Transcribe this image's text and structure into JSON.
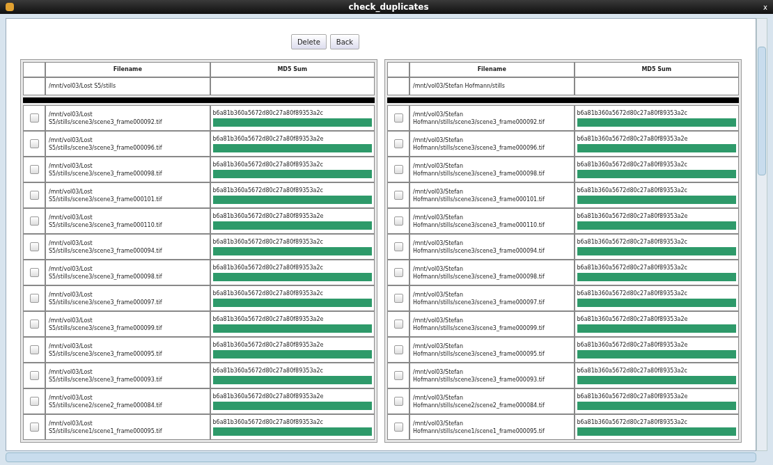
{
  "window": {
    "title": "check_duplicates",
    "close": "x"
  },
  "buttons": [
    "Delete",
    "Back"
  ],
  "tables": [
    {
      "columns": [
        "Filename",
        "MD5 Sum"
      ],
      "folder": "/mnt/vol03/Lost S5/stills",
      "rows": [
        {
          "checked": false,
          "path_1": "/mnt/vol03/Lost",
          "path_2": "S5/stills/scene3/scene3_frame000092.tif",
          "md5": "b6a81b360a5672d80c27a80f89353a2c",
          "match": true
        },
        {
          "checked": false,
          "path_1": "/mnt/vol03/Lost",
          "path_2": "S5/stills/scene3/scene3_frame000096.tif",
          "md5": "b6a81b360a5672d80c27a80f89353a2e",
          "match": true
        },
        {
          "checked": false,
          "path_1": "/mnt/vol03/Lost",
          "path_2": "S5/stills/scene3/scene3_frame000098.tif",
          "md5": "b6a81b360a5672d80c27a80f89353a2c",
          "match": true
        },
        {
          "checked": false,
          "path_1": "/mnt/vol03/Lost",
          "path_2": "S5/stills/scene3/scene3_frame000101.tif",
          "md5": "b6a81b360a5672d80c27a80f89353a2c",
          "match": true
        },
        {
          "checked": false,
          "path_1": "/mnt/vol03/Lost",
          "path_2": "S5/stills/scene3/scene3_frame000110.tif",
          "md5": "b6a81b360a5672d80c27a80f89353a2e",
          "match": true
        },
        {
          "checked": false,
          "path_1": "/mnt/vol03/Lost",
          "path_2": "S5/stills/scene3/scene3_frame000094.tif",
          "md5": "b6a81b360a5672d80c27a80f89353a2c",
          "match": true
        },
        {
          "checked": false,
          "path_1": "/mnt/vol03/Lost",
          "path_2": "S5/stills/scene3/scene3_frame000098.tif",
          "md5": "b6a81b360a5672d80c27a80f89353a2c",
          "match": true
        },
        {
          "checked": false,
          "path_1": "/mnt/vol03/Lost",
          "path_2": "S5/stills/scene3/scene3_frame000097.tif",
          "md5": "b6a81b360a5672d80c27a80f89353a2c",
          "match": true
        },
        {
          "checked": false,
          "path_1": "/mnt/vol03/Lost",
          "path_2": "S5/stills/scene3/scene3_frame000099.tif",
          "md5": "b6a81b360a5672d80c27a80f89353a2e",
          "match": true
        },
        {
          "checked": false,
          "path_1": "/mnt/vol03/Lost",
          "path_2": "S5/stills/scene3/scene3_frame000095.tif",
          "md5": "b6a81b360a5672d80c27a80f89353a2e",
          "match": true
        },
        {
          "checked": false,
          "path_1": "/mnt/vol03/Lost",
          "path_2": "S5/stills/scene3/scene3_frame000093.tif",
          "md5": "b6a81b360a5672d80c27a80f89353a2c",
          "match": true
        },
        {
          "checked": false,
          "path_1": "/mnt/vol03/Lost",
          "path_2": "S5/stills/scene2/scene2_frame000084.tif",
          "md5": "b6a81b360a5672d80c27a80f89353a2e",
          "match": true
        },
        {
          "checked": false,
          "path_1": "/mnt/vol03/Lost",
          "path_2": "S5/stills/scene1/scene1_frame000095.tif",
          "md5": "b6a81b360a5672d80c27a80f89353a2c",
          "match": true
        }
      ]
    },
    {
      "columns": [
        "Filename",
        "MD5 Sum"
      ],
      "folder": "/mnt/vol03/Stefan Hofmann/stills",
      "rows": [
        {
          "checked": false,
          "path_1": "/mnt/vol03/Stefan",
          "path_2": "Hofmann/stills/scene3/scene3_frame000092.tif",
          "md5": "b6a81b360a5672d80c27a80f89353a2c",
          "match": true
        },
        {
          "checked": false,
          "path_1": "/mnt/vol03/Stefan",
          "path_2": "Hofmann/stills/scene3/scene3_frame000096.tif",
          "md5": "b6a81b360a5672d80c27a80f89353a2e",
          "match": true
        },
        {
          "checked": false,
          "path_1": "/mnt/vol03/Stefan",
          "path_2": "Hofmann/stills/scene3/scene3_frame000098.tif",
          "md5": "b6a81b360a5672d80c27a80f89353a2c",
          "match": true
        },
        {
          "checked": false,
          "path_1": "/mnt/vol03/Stefan",
          "path_2": "Hofmann/stills/scene3/scene3_frame000101.tif",
          "md5": "b6a81b360a5672d80c27a80f89353a2c",
          "match": true
        },
        {
          "checked": false,
          "path_1": "/mnt/vol03/Stefan",
          "path_2": "Hofmann/stills/scene3/scene3_frame000110.tif",
          "md5": "b6a81b360a5672d80c27a80f89353a2e",
          "match": true
        },
        {
          "checked": false,
          "path_1": "/mnt/vol03/Stefan",
          "path_2": "Hofmann/stills/scene3/scene3_frame000094.tif",
          "md5": "b6a81b360a5672d80c27a80f89353a2c",
          "match": true
        },
        {
          "checked": false,
          "path_1": "/mnt/vol03/Stefan",
          "path_2": "Hofmann/stills/scene3/scene3_frame000098.tif",
          "md5": "b6a81b360a5672d80c27a80f89353a2c",
          "match": true
        },
        {
          "checked": false,
          "path_1": "/mnt/vol03/Stefan",
          "path_2": "Hofmann/stills/scene3/scene3_frame000097.tif",
          "md5": "b6a81b360a5672d80c27a80f89353a2c",
          "match": true
        },
        {
          "checked": false,
          "path_1": "/mnt/vol03/Stefan",
          "path_2": "Hofmann/stills/scene3/scene3_frame000099.tif",
          "md5": "b6a81b360a5672d80c27a80f89353a2e",
          "match": true
        },
        {
          "checked": false,
          "path_1": "/mnt/vol03/Stefan",
          "path_2": "Hofmann/stills/scene3/scene3_frame000095.tif",
          "md5": "b6a81b360a5672d80c27a80f89353a2e",
          "match": true
        },
        {
          "checked": false,
          "path_1": "/mnt/vol03/Stefan",
          "path_2": "Hofmann/stills/scene3/scene3_frame000093.tif",
          "md5": "b6a81b360a5672d80c27a80f89353a2c",
          "match": true
        },
        {
          "checked": false,
          "path_1": "/mnt/vol03/Stefan",
          "path_2": "Hofmann/stills/scene2/scene2_frame000084.tif",
          "md5": "b6a81b360a5672d80c27a80f89353a2e",
          "match": true
        },
        {
          "checked": false,
          "path_1": "/mnt/vol03/Stefan",
          "path_2": "Hofmann/stills/scene1/scene1_frame000095.tif",
          "md5": "b6a81b360a5672d80c27a80f89353a2c",
          "match": true
        }
      ]
    }
  ]
}
